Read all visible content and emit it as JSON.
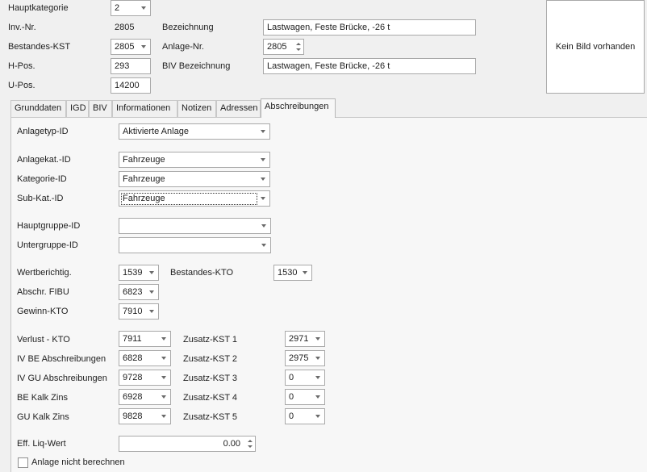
{
  "header": {
    "hauptkategorie": {
      "label": "Hauptkategorie",
      "value": "2"
    },
    "inv_nr": {
      "label": "Inv.-Nr.",
      "value": "2805"
    },
    "bestandes_kst": {
      "label": "Bestandes-KST",
      "value": "2805"
    },
    "h_pos": {
      "label": "H-Pos.",
      "value": "293"
    },
    "u_pos": {
      "label": "U-Pos.",
      "value": "14200"
    },
    "bezeichnung": {
      "label": "Bezeichnung",
      "value": "Lastwagen, Feste Brücke, -26 t"
    },
    "anlage_nr": {
      "label": "Anlage-Nr.",
      "value": "2805"
    },
    "biv_bezeichnung": {
      "label": "BIV Bezeichnung",
      "value": "Lastwagen, Feste Brücke, -26 t"
    },
    "image_placeholder": "Kein Bild vorhanden"
  },
  "tabs": [
    "Grunddaten",
    "IGD",
    "BIV",
    "Informationen",
    "Notizen",
    "Adressen",
    "Abschreibungen"
  ],
  "active_tab": "Abschreibungen",
  "form": {
    "anlagetyp": {
      "label": "Anlagetyp-ID",
      "value": "Aktivierte Anlage"
    },
    "anlagekat": {
      "label": "Anlagekat.-ID",
      "value": "Fahrzeuge"
    },
    "kategorie": {
      "label": "Kategorie-ID",
      "value": "Fahrzeuge"
    },
    "subkat": {
      "label": "Sub-Kat.-ID",
      "value": "Fahrzeuge"
    },
    "hauptgruppe": {
      "label": "Hauptgruppe-ID",
      "value": ""
    },
    "untergruppe": {
      "label": "Untergruppe-ID",
      "value": ""
    },
    "wertberichtig": {
      "label": "Wertberichtig.",
      "value": "1539"
    },
    "bestandes_kto": {
      "label": "Bestandes-KTO",
      "value": "1530"
    },
    "abschr_fibu": {
      "label": "Abschr. FIBU",
      "value": "6823"
    },
    "gewinn_kto": {
      "label": "Gewinn-KTO",
      "value": "7910"
    },
    "verlust_kto": {
      "label": "Verlust - KTO",
      "value": "7911"
    },
    "iv_be": {
      "label": "IV BE Abschreibungen",
      "value": "6828"
    },
    "iv_gu": {
      "label": "IV GU Abschreibungen",
      "value": "9728"
    },
    "be_kalk": {
      "label": "BE Kalk Zins",
      "value": "6928"
    },
    "gu_kalk": {
      "label": "GU Kalk Zins",
      "value": "9828"
    },
    "zusatz1": {
      "label": "Zusatz-KST 1",
      "value": "2971"
    },
    "zusatz2": {
      "label": "Zusatz-KST 2",
      "value": "2975"
    },
    "zusatz3": {
      "label": "Zusatz-KST 3",
      "value": "0"
    },
    "zusatz4": {
      "label": "Zusatz-KST 4",
      "value": "0"
    },
    "zusatz5": {
      "label": "Zusatz-KST 5",
      "value": "0"
    },
    "eff_liq": {
      "label": "Eff. Liq-Wert",
      "value": "0.00"
    },
    "nicht_berechnen": {
      "label": "Anlage nicht berechnen",
      "checked": false
    }
  }
}
